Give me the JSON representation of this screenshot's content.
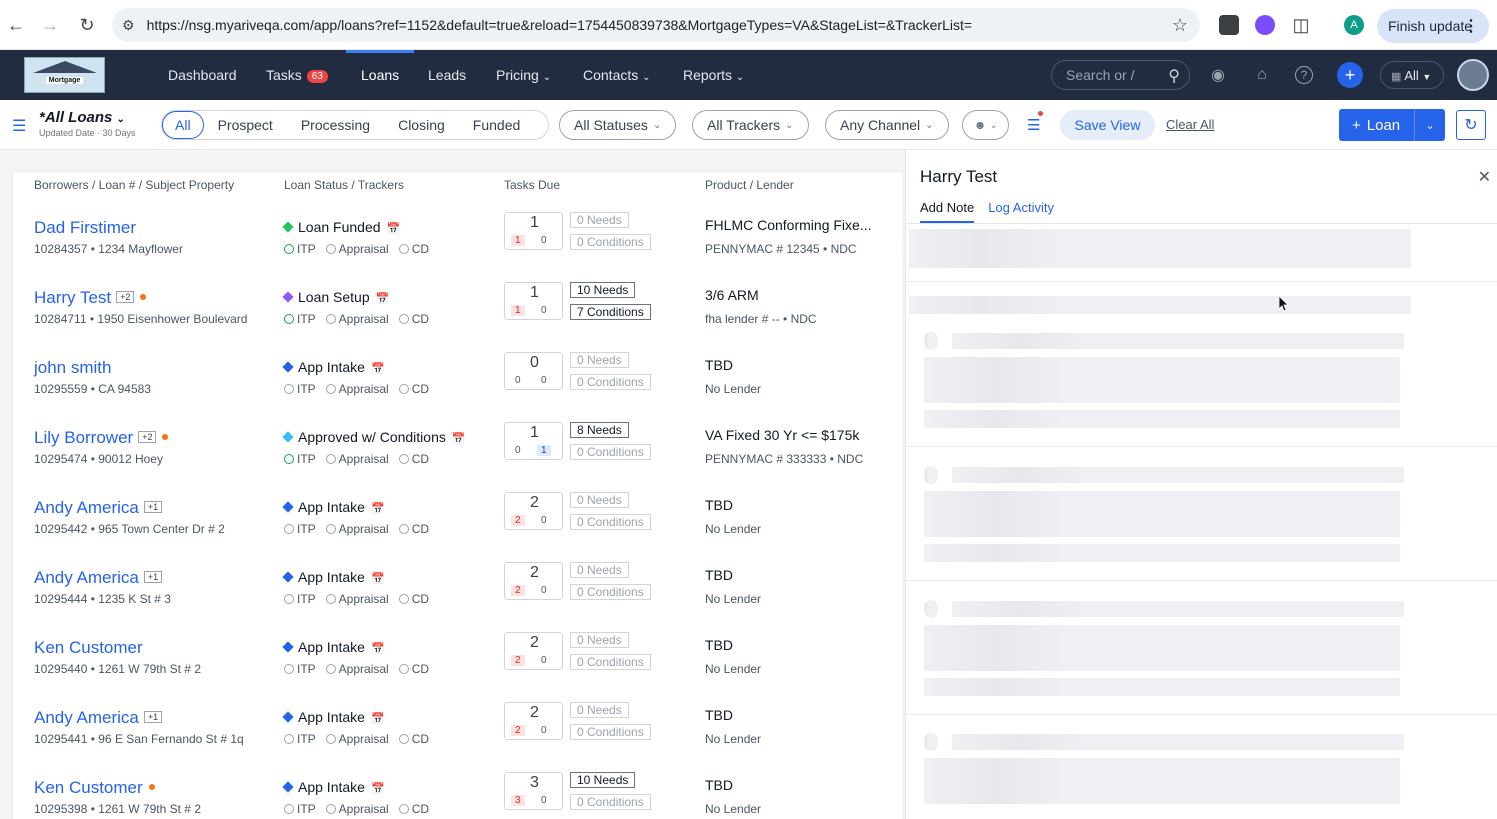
{
  "browser": {
    "url": "https://nsg.myariveqa.com/app/loans?ref=1152&default=true&reload=1754450839738&MortgageTypes=VA&StageList=&TrackerList=",
    "profile_initial": "A",
    "finish_update": "Finish update"
  },
  "logo": {
    "text": "Mortgage"
  },
  "nav": {
    "dashboard": "Dashboard",
    "tasks": "Tasks",
    "tasks_count": "63",
    "loans": "Loans",
    "leads": "Leads",
    "pricing": "Pricing",
    "contacts": "Contacts",
    "reports": "Reports",
    "search_placeholder": "Search or /",
    "all_select": "All"
  },
  "filters": {
    "view_title": "*All Loans",
    "view_sub": "Updated Date · 30 Days",
    "segments": [
      "All",
      "Prospect",
      "Processing",
      "Closing",
      "Funded"
    ],
    "statuses": "All Statuses",
    "trackers": "All Trackers",
    "channel": "Any Channel",
    "save_view": "Save View",
    "clear_all": "Clear All",
    "loan_button": "Loan"
  },
  "columns": {
    "borrowers": "Borrowers / Loan # / Subject Property",
    "status": "Loan Status / Trackers",
    "tasks": "Tasks Due",
    "product": "Product / Lender"
  },
  "trackers": [
    "ITP",
    "Appraisal",
    "CD"
  ],
  "rows": [
    {
      "name": "Dad Firstimer",
      "tag": "",
      "dot": false,
      "loan": "10284357 • 1234 Mayflower",
      "status": "Loan Funded",
      "status_color": "#22c55e",
      "itp": true,
      "tasks": "1",
      "a": "1",
      "b": "0",
      "b_blue": false,
      "needs": "0 Needs",
      "needs_on": false,
      "conds": "0 Conditions",
      "conds_on": false,
      "product": "FHLMC Conforming Fixe...",
      "lender": "PENNYMAC # 12345 • NDC"
    },
    {
      "name": "Harry Test",
      "tag": "+2",
      "dot": true,
      "loan": "10284711 • 1950 Eisenhower Boulevard",
      "status": "Loan Setup",
      "status_color": "#8b5cf6",
      "itp": true,
      "tasks": "1",
      "a": "1",
      "b": "0",
      "b_blue": false,
      "needs": "10 Needs",
      "needs_on": true,
      "conds": "7 Conditions",
      "conds_on": true,
      "product": "3/6 ARM",
      "lender": "fha lender # -- • NDC"
    },
    {
      "name": "john smith",
      "tag": "",
      "dot": false,
      "loan": "10295559 • CA 94583",
      "status": "App Intake",
      "status_color": "#2563eb",
      "itp": false,
      "tasks": "0",
      "a": "0",
      "b": "0",
      "b_blue": false,
      "needs": "0 Needs",
      "needs_on": false,
      "conds": "0 Conditions",
      "conds_on": false,
      "product": "TBD",
      "lender": "No Lender"
    },
    {
      "name": "Lily Borrower",
      "tag": "+2",
      "dot": true,
      "loan": "10295474 • 90012 Hoey",
      "status": "Approved w/ Conditions",
      "status_color": "#38bdf8",
      "itp": true,
      "tasks": "1",
      "a": "0",
      "b": "1",
      "b_blue": true,
      "needs": "8 Needs",
      "needs_on": true,
      "conds": "0 Conditions",
      "conds_on": false,
      "product": "VA Fixed 30 Yr <= $175k",
      "lender": "PENNYMAC # 333333 • NDC"
    },
    {
      "name": "Andy America",
      "tag": "+1",
      "dot": false,
      "loan": "10295442 • 965 Town Center Dr # 2",
      "status": "App Intake",
      "status_color": "#2563eb",
      "itp": false,
      "tasks": "2",
      "a": "2",
      "b": "0",
      "b_blue": false,
      "needs": "0 Needs",
      "needs_on": false,
      "conds": "0 Conditions",
      "conds_on": false,
      "product": "TBD",
      "lender": "No Lender"
    },
    {
      "name": "Andy America",
      "tag": "+1",
      "dot": false,
      "loan": "10295444 • 1235 K St # 3",
      "status": "App Intake",
      "status_color": "#2563eb",
      "itp": false,
      "tasks": "2",
      "a": "2",
      "b": "0",
      "b_blue": false,
      "needs": "0 Needs",
      "needs_on": false,
      "conds": "0 Conditions",
      "conds_on": false,
      "product": "TBD",
      "lender": "No Lender"
    },
    {
      "name": "Ken Customer",
      "tag": "",
      "dot": false,
      "loan": "10295440 • 1261 W 79th St # 2",
      "status": "App Intake",
      "status_color": "#2563eb",
      "itp": false,
      "tasks": "2",
      "a": "2",
      "b": "0",
      "b_blue": false,
      "needs": "0 Needs",
      "needs_on": false,
      "conds": "0 Conditions",
      "conds_on": false,
      "product": "TBD",
      "lender": "No Lender"
    },
    {
      "name": "Andy America",
      "tag": "+1",
      "dot": false,
      "loan": "10295441 • 96 E San Fernando St # 1q",
      "status": "App Intake",
      "status_color": "#2563eb",
      "itp": false,
      "tasks": "2",
      "a": "2",
      "b": "0",
      "b_blue": false,
      "needs": "0 Needs",
      "needs_on": false,
      "conds": "0 Conditions",
      "conds_on": false,
      "product": "TBD",
      "lender": "No Lender"
    },
    {
      "name": "Ken Customer",
      "tag": "",
      "dot": true,
      "loan": "10295398 • 1261 W 79th St # 2",
      "status": "App Intake",
      "status_color": "#2563eb",
      "itp": false,
      "tasks": "3",
      "a": "3",
      "b": "0",
      "b_blue": false,
      "needs": "10 Needs",
      "needs_on": true,
      "conds": "0 Conditions",
      "conds_on": false,
      "product": "TBD",
      "lender": "No Lender"
    }
  ],
  "panel": {
    "title": "Harry Test",
    "tab_note": "Add Note",
    "tab_activity": "Log Activity"
  }
}
